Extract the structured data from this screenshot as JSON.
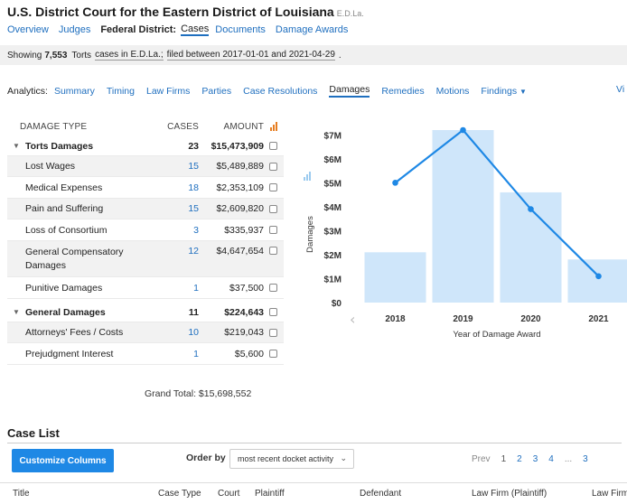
{
  "header": {
    "title": "U.S. District Court for the Eastern District of Louisiana",
    "abbr": "E.D.La."
  },
  "topnav": {
    "overview": "Overview",
    "judges": "Judges",
    "federal_district_label": "Federal District:",
    "cases": "Cases",
    "documents": "Documents",
    "damage_awards": "Damage Awards"
  },
  "showing": {
    "prefix": "Showing",
    "count": "7,553",
    "category": "Torts",
    "scope": "cases in E.D.La.;",
    "filed": "filed between 2017-01-01 and 2021-04-29",
    "dot": "."
  },
  "analytics": {
    "label": "Analytics:",
    "tabs": [
      "Summary",
      "Timing",
      "Law Firms",
      "Parties",
      "Case Resolutions",
      "Damages",
      "Remedies",
      "Motions",
      "Findings"
    ],
    "active": "Damages",
    "overflow": "Vi"
  },
  "damage_table": {
    "headers": {
      "type": "DAMAGE TYPE",
      "cases": "CASES",
      "amount": "AMOUNT"
    },
    "groups": [
      {
        "label": "Torts Damages",
        "cases": "23",
        "amount": "$15,473,909",
        "rows": [
          {
            "label": "Lost Wages",
            "cases": "15",
            "amount": "$5,489,889"
          },
          {
            "label": "Medical Expenses",
            "cases": "18",
            "amount": "$2,353,109"
          },
          {
            "label": "Pain and Suffering",
            "cases": "15",
            "amount": "$2,609,820"
          },
          {
            "label": "Loss of Consortium",
            "cases": "3",
            "amount": "$335,937"
          },
          {
            "label": "General Compensatory",
            "label2": "Damages",
            "cases": "12",
            "amount": "$4,647,654"
          },
          {
            "label": "Punitive Damages",
            "cases": "1",
            "amount": "$37,500"
          }
        ]
      },
      {
        "label": "General Damages",
        "cases": "11",
        "amount": "$224,643",
        "rows": [
          {
            "label": "Attorneys' Fees / Costs",
            "cases": "10",
            "amount": "$219,043"
          },
          {
            "label": "Prejudgment Interest",
            "cases": "1",
            "amount": "$5,600"
          }
        ]
      }
    ],
    "grand_total": "Grand Total: $15,698,552"
  },
  "chart_data": {
    "type": "bar",
    "categories": [
      "2018",
      "2019",
      "2020",
      "2021"
    ],
    "series": [
      {
        "values": [
          2.1,
          7.2,
          4.6,
          1.8
        ]
      },
      {
        "values": [
          5.0,
          7.2,
          3.9,
          1.1
        ]
      }
    ],
    "y_ticks": [
      "$0",
      "$1M",
      "$2M",
      "$3M",
      "$4M",
      "$5M",
      "$6M",
      "$7M"
    ],
    "ylim": [
      0,
      7.2
    ],
    "xlabel": "Year of Damage Award",
    "ylabel": "Damages",
    "colors": {
      "bar": "#cfe6fa",
      "line": "#1e88e5"
    },
    "grid": false
  },
  "case_list": {
    "title": "Case List",
    "customize_label": "Customize Columns",
    "order_by_label": "Order by",
    "order_by_value": "most recent docket activity",
    "pager": {
      "prev": "Prev",
      "pages": [
        "1",
        "2",
        "3",
        "4"
      ],
      "current": "1",
      "ellipsis": "...",
      "last_partial": "3"
    },
    "columns": [
      "Title",
      "Case Type",
      "Court",
      "Plaintiff",
      "Defendant",
      "Law Firm (Plaintiff)",
      "Law Firm"
    ]
  }
}
